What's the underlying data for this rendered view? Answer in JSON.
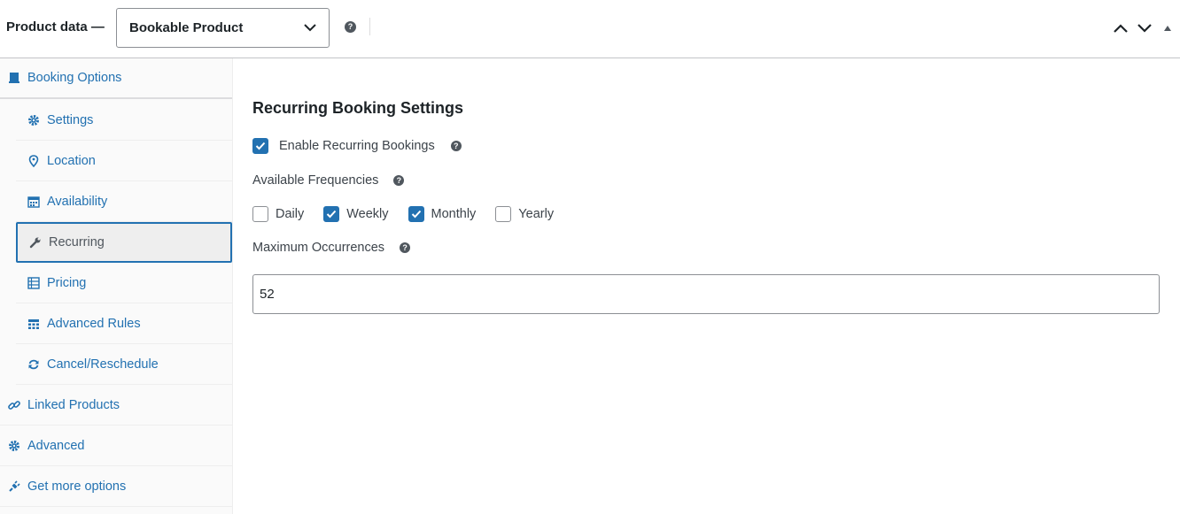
{
  "header": {
    "title": "Product data —",
    "product_type": "Bookable Product"
  },
  "sidebar": {
    "items": [
      {
        "label": "Booking Options",
        "icon": "book-icon"
      },
      {
        "label": "Settings",
        "icon": "gear-icon"
      },
      {
        "label": "Location",
        "icon": "location-pin-icon"
      },
      {
        "label": "Availability",
        "icon": "calendar-icon"
      },
      {
        "label": "Recurring",
        "icon": "wrench-icon",
        "active": true
      },
      {
        "label": "Pricing",
        "icon": "list-icon"
      },
      {
        "label": "Advanced Rules",
        "icon": "grid-icon"
      },
      {
        "label": "Cancel/Reschedule",
        "icon": "refresh-icon"
      },
      {
        "label": "Linked Products",
        "icon": "link-icon"
      },
      {
        "label": "Advanced",
        "icon": "gear-icon"
      },
      {
        "label": "Get more options",
        "icon": "plugin-icon"
      }
    ]
  },
  "main": {
    "section_title": "Recurring Booking Settings",
    "enable_label": "Enable Recurring Bookings",
    "enable_checked": true,
    "frequencies_label": "Available Frequencies",
    "frequencies": [
      {
        "label": "Daily",
        "checked": false
      },
      {
        "label": "Weekly",
        "checked": true
      },
      {
        "label": "Monthly",
        "checked": true
      },
      {
        "label": "Yearly",
        "checked": false
      }
    ],
    "max_occurrences_label": "Maximum Occurrences",
    "max_occurrences_value": "52"
  },
  "colors": {
    "accent": "#2271b1",
    "link": "#2271b1"
  }
}
